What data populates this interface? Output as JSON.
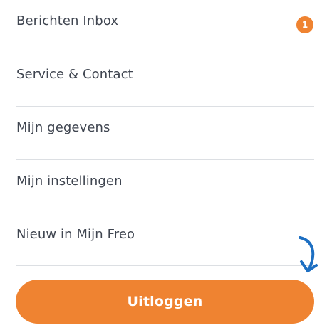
{
  "menu": {
    "items": [
      {
        "label": "Berichten Inbox",
        "badge": "1"
      },
      {
        "label": "Service & Contact"
      },
      {
        "label": "Mijn gegevens"
      },
      {
        "label": "Mijn instellingen"
      },
      {
        "label": "Nieuw in Mijn Freo"
      }
    ]
  },
  "logout": {
    "label": "Uitloggen"
  },
  "annotation": {
    "icon": "curved-arrow-down-icon",
    "color": "#1d6fc2"
  },
  "colors": {
    "accent": "#ef8331",
    "text": "#3f4550",
    "divider": "#dcdfe3"
  }
}
